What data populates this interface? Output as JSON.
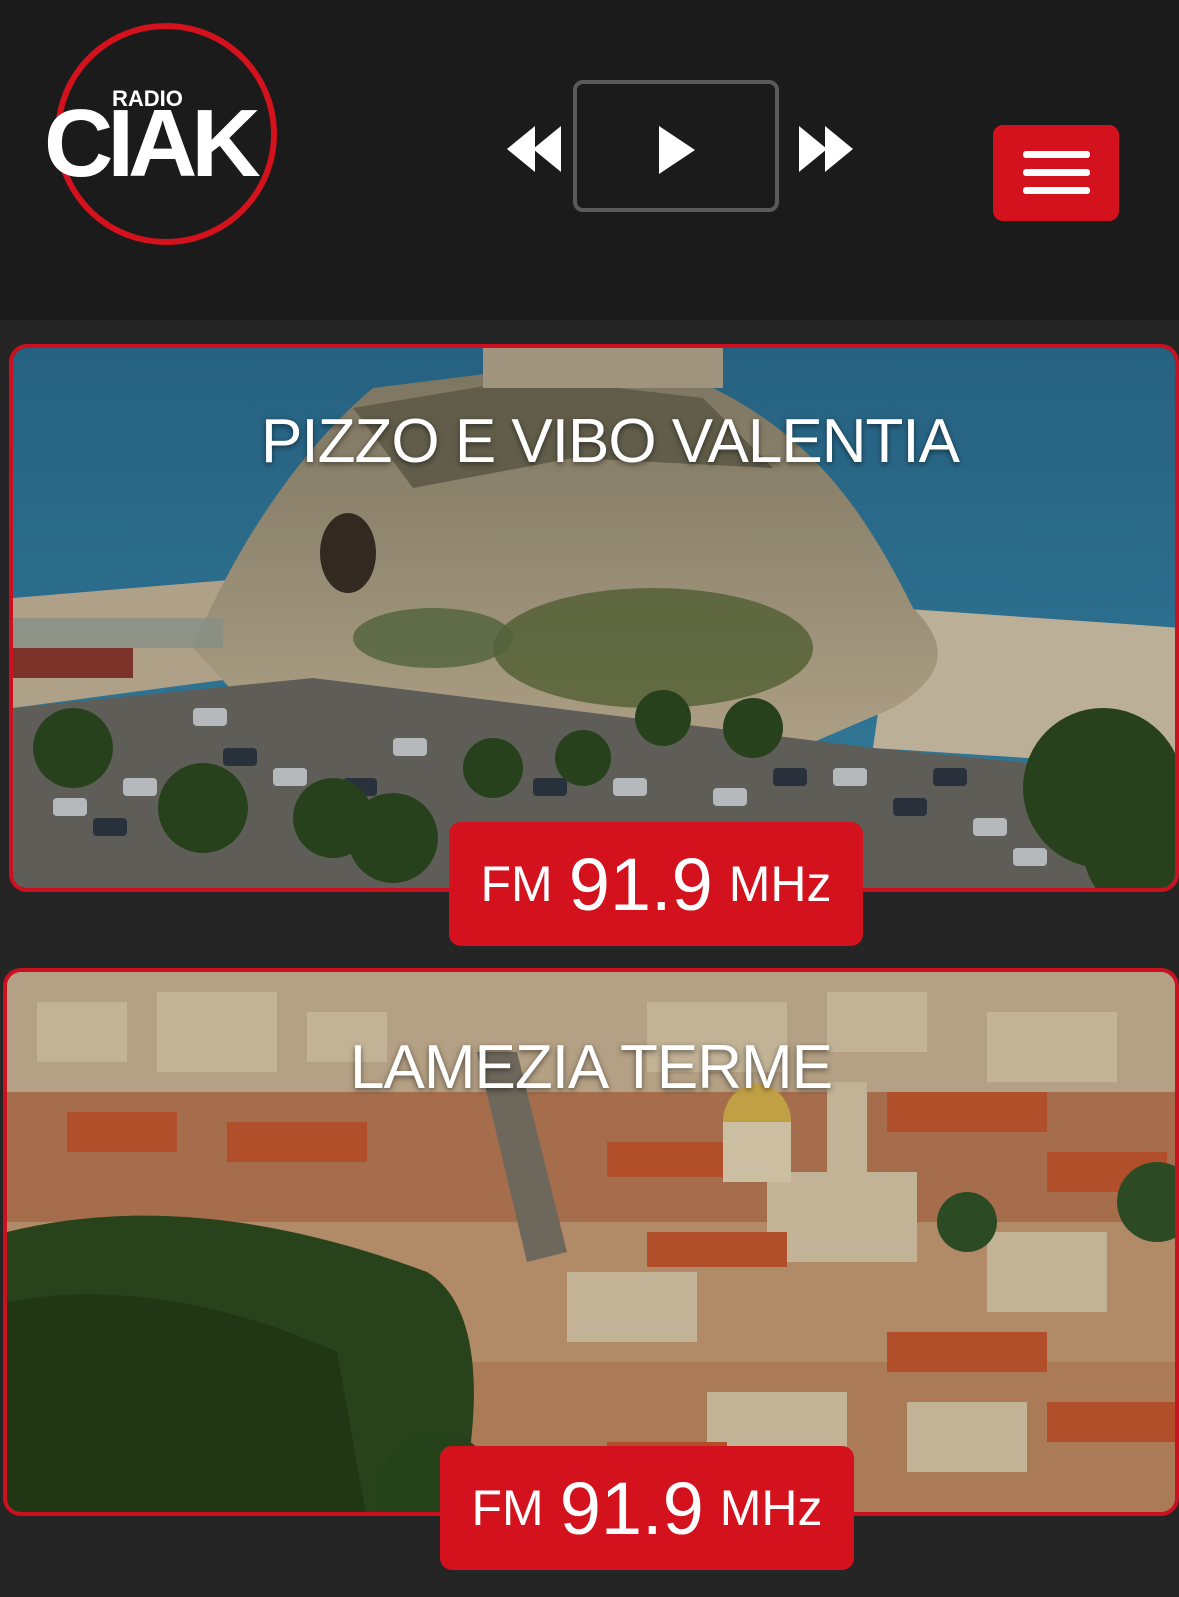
{
  "header": {
    "logo": {
      "text_small": "RADIO",
      "text_big": "CIAK",
      "ring_color": "#d3121d"
    },
    "player": {
      "prev_icon": "rewind-icon",
      "play_icon": "play-icon",
      "next_icon": "fast-forward-icon"
    },
    "menu_icon": "hamburger-icon",
    "accent_color": "#d3121d"
  },
  "stations": [
    {
      "name": "PIZZO E VIBO VALENTIA",
      "band": "FM",
      "frequency": "91.9",
      "unit": "MHz"
    },
    {
      "name": "LAMEZIA TERME",
      "band": "FM",
      "frequency": "91.9",
      "unit": "MHz"
    }
  ]
}
